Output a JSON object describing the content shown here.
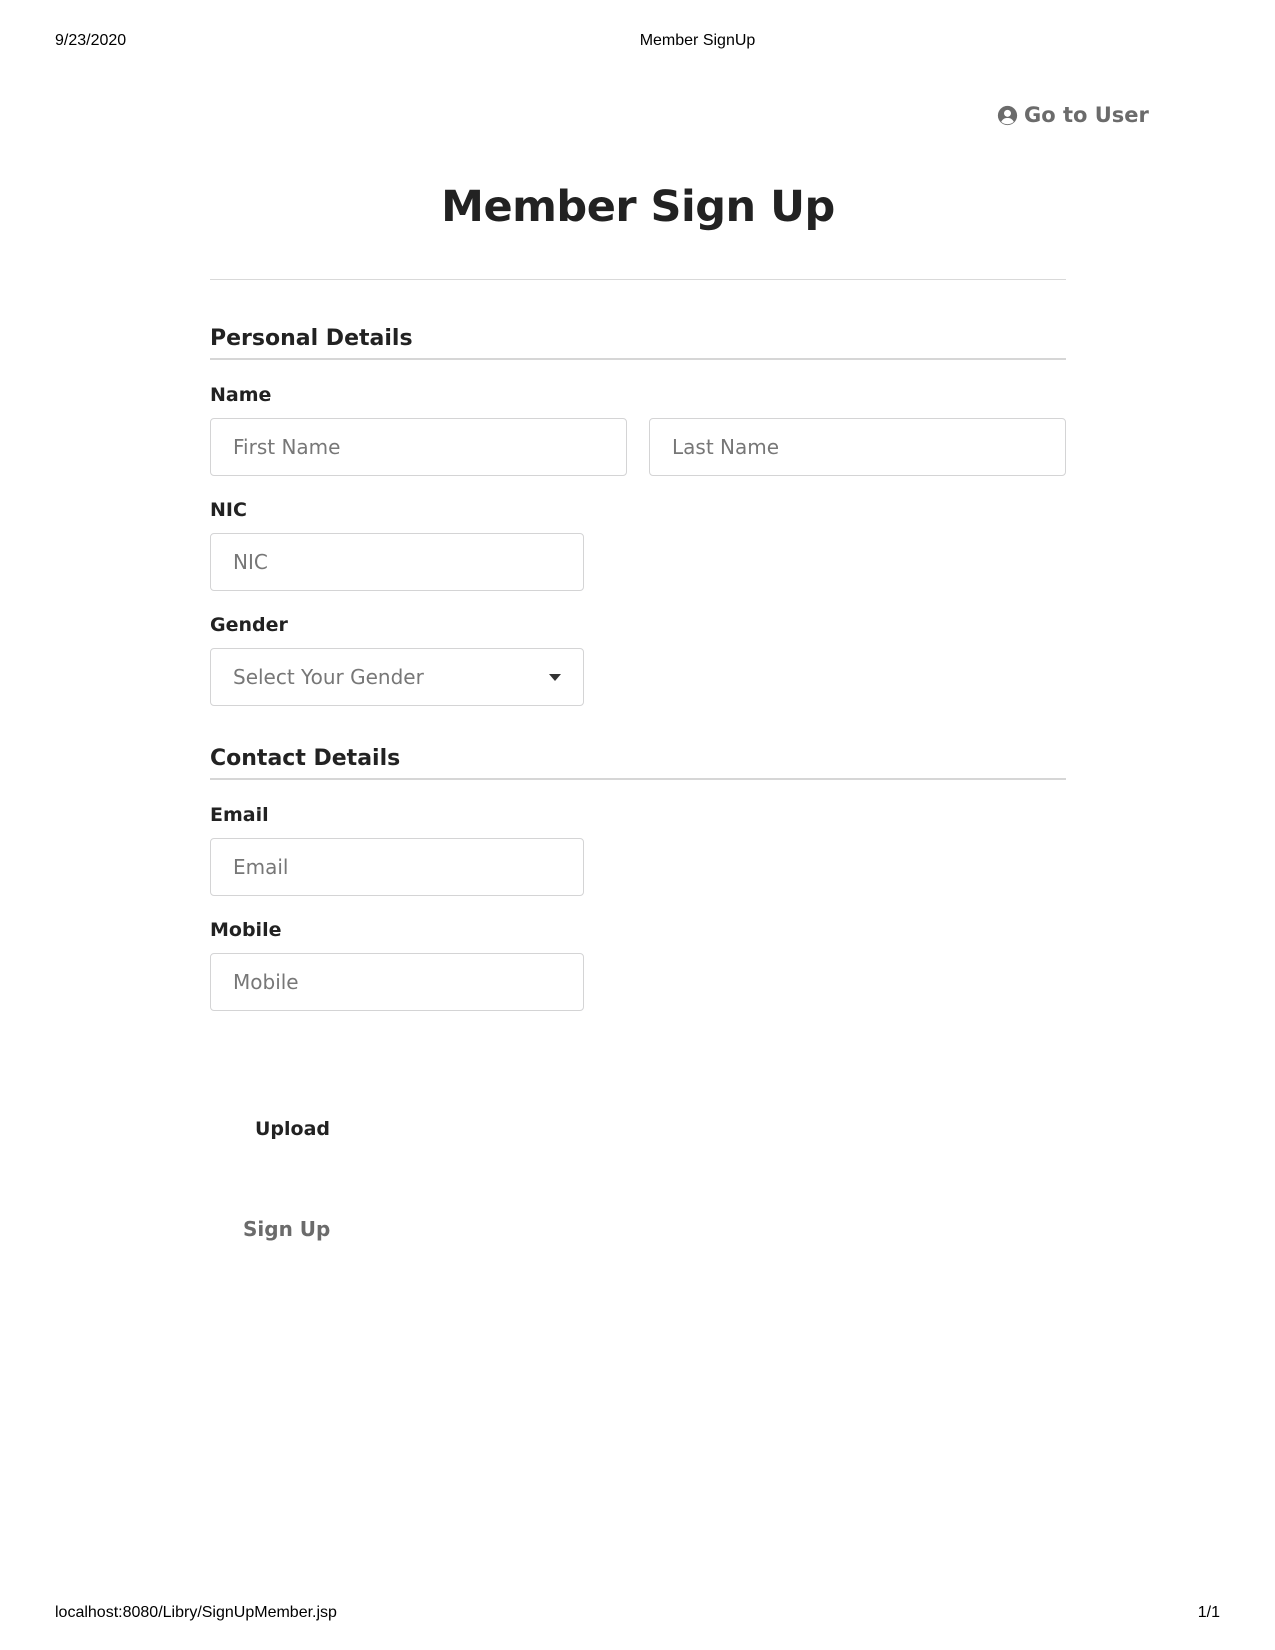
{
  "print_header": {
    "date": "9/23/2020",
    "page_title": "Member SignUp"
  },
  "print_footer": {
    "url": "localhost:8080/Libry/SignUpMember.jsp",
    "page_number": "1/1"
  },
  "nav": {
    "go_to_user_label": "Go to User",
    "go_to_user_icon": "user-circle-icon"
  },
  "form": {
    "title": "Member Sign Up",
    "personal_section": {
      "title": "Personal Details",
      "name_label": "Name",
      "first_name_placeholder": "First Name",
      "last_name_placeholder": "Last Name",
      "nic_label": "NIC",
      "nic_placeholder": "NIC",
      "gender_label": "Gender",
      "gender_selected": "Select Your Gender"
    },
    "contact_section": {
      "title": "Contact Details",
      "email_label": "Email",
      "email_placeholder": "Email",
      "mobile_label": "Mobile",
      "mobile_placeholder": "Mobile"
    },
    "upload_label": "Upload",
    "submit_label": "Sign Up"
  },
  "colors": {
    "text_dark": "#222222",
    "text_muted": "#6b6b6b",
    "border": "#d4d4d5"
  }
}
